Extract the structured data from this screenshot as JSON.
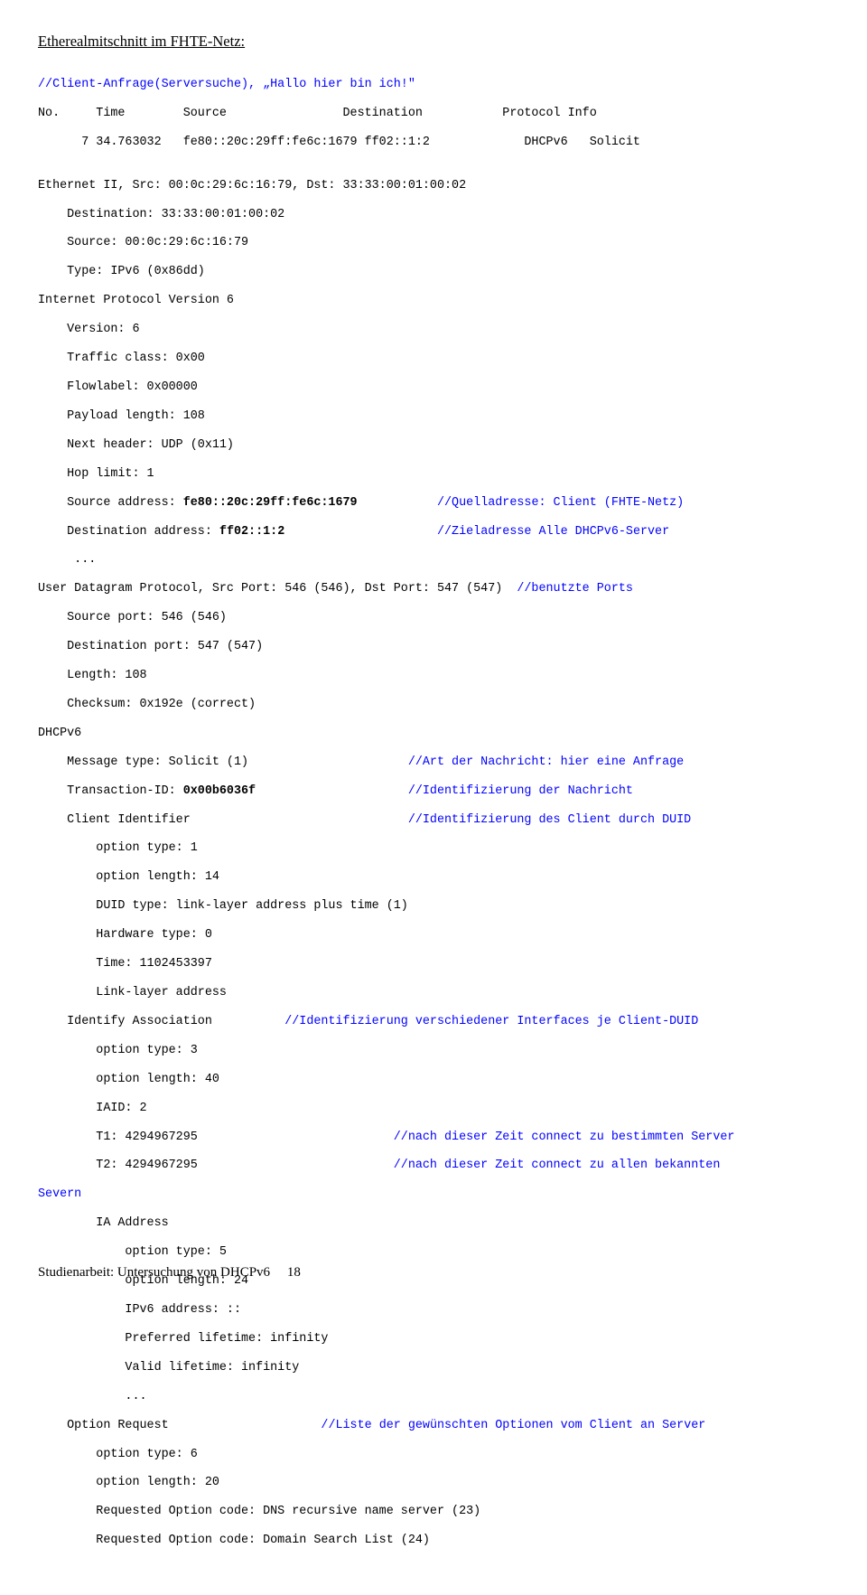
{
  "heading": "Etherealmitschnitt im FHTE-Netz:",
  "c": {
    "l01": "//Client-Anfrage(Serversuche), „Hallo hier bin ich!\"",
    "l02": "No.     Time        Source                Destination           Protocol Info",
    "l03": "      7 34.763032   fe80::20c:29ff:fe6c:1679 ff02::1:2             DHCPv6   Solicit",
    "l04": "",
    "l05": "Ethernet II, Src: 00:0c:29:6c:16:79, Dst: 33:33:00:01:00:02",
    "l06": "    Destination: 33:33:00:01:00:02",
    "l07": "    Source: 00:0c:29:6c:16:79",
    "l08": "    Type: IPv6 (0x86dd)",
    "l09": "Internet Protocol Version 6",
    "l10": "    Version: 6",
    "l11": "    Traffic class: 0x00",
    "l12": "    Flowlabel: 0x00000",
    "l13": "    Payload length: 108",
    "l14": "    Next header: UDP (0x11)",
    "l15": "    Hop limit: 1",
    "l16a": "    Source address: ",
    "l16b": "fe80::20c:29ff:fe6c:1679",
    "l16c": "           ",
    "l16d": "//Quelladresse: Client (FHTE-Netz)",
    "l17a": "    Destination address: ",
    "l17b": "ff02::1:2",
    "l17c": "                     ",
    "l17d": "//Zieladresse Alle DHCPv6-Server",
    "l18": "     ...",
    "l19a": "User Datagram Protocol, Src Port: 546 (546), Dst Port: 547 (547)  ",
    "l19b": "//benutzte Ports",
    "l20": "    Source port: 546 (546)",
    "l21": "    Destination port: 547 (547)",
    "l22": "    Length: 108",
    "l23": "    Checksum: 0x192e (correct)",
    "l24": "DHCPv6",
    "l25a": "    Message type: Solicit (1)                      ",
    "l25b": "//Art der Nachricht: hier eine Anfrage",
    "l26a": "    Transaction-ID: ",
    "l26b": "0x00b6036f",
    "l26c": "                     ",
    "l26d": "//Identifizierung der Nachricht",
    "l27a": "    Client Identifier                              ",
    "l27b": "//Identifizierung des Client durch DUID",
    "l28": "        option type: 1",
    "l29": "        option length: 14",
    "l30": "        DUID type: link-layer address plus time (1)",
    "l31": "        Hardware type: 0",
    "l32": "        Time: 1102453397",
    "l33": "        Link-layer address",
    "l34a": "    Identify Association          ",
    "l34b": "//Identifizierung verschiedener Interfaces je Client-DUID",
    "l35": "        option type: 3",
    "l36": "        option length: 40",
    "l37": "        IAID: 2",
    "l38a": "        T1: 4294967295                           ",
    "l38b": "//nach dieser Zeit connect zu bestimmten Server",
    "l39a": "        T2: 4294967295                           ",
    "l39b": "//nach dieser Zeit connect zu allen bekannten",
    "l40": "Severn",
    "l41": "        IA Address",
    "l42": "            option type: 5",
    "l43": "            option length: 24",
    "l44": "            IPv6 address: ::",
    "l45": "            Preferred lifetime: infinity",
    "l46": "            Valid lifetime: infinity",
    "l47": "            ...",
    "l48a": "    Option Request                     ",
    "l48b": "//Liste der gewünschten Optionen vom Client an Server",
    "l49": "        option type: 6",
    "l50": "        option length: 20",
    "l51": "        Requested Option code: DNS recursive name server (23)",
    "l52": "        Requested Option code: Domain Search List (24)"
  },
  "footer": {
    "text": "Studienarbeit: Untersuchung von DHCPv6",
    "page": "18"
  }
}
